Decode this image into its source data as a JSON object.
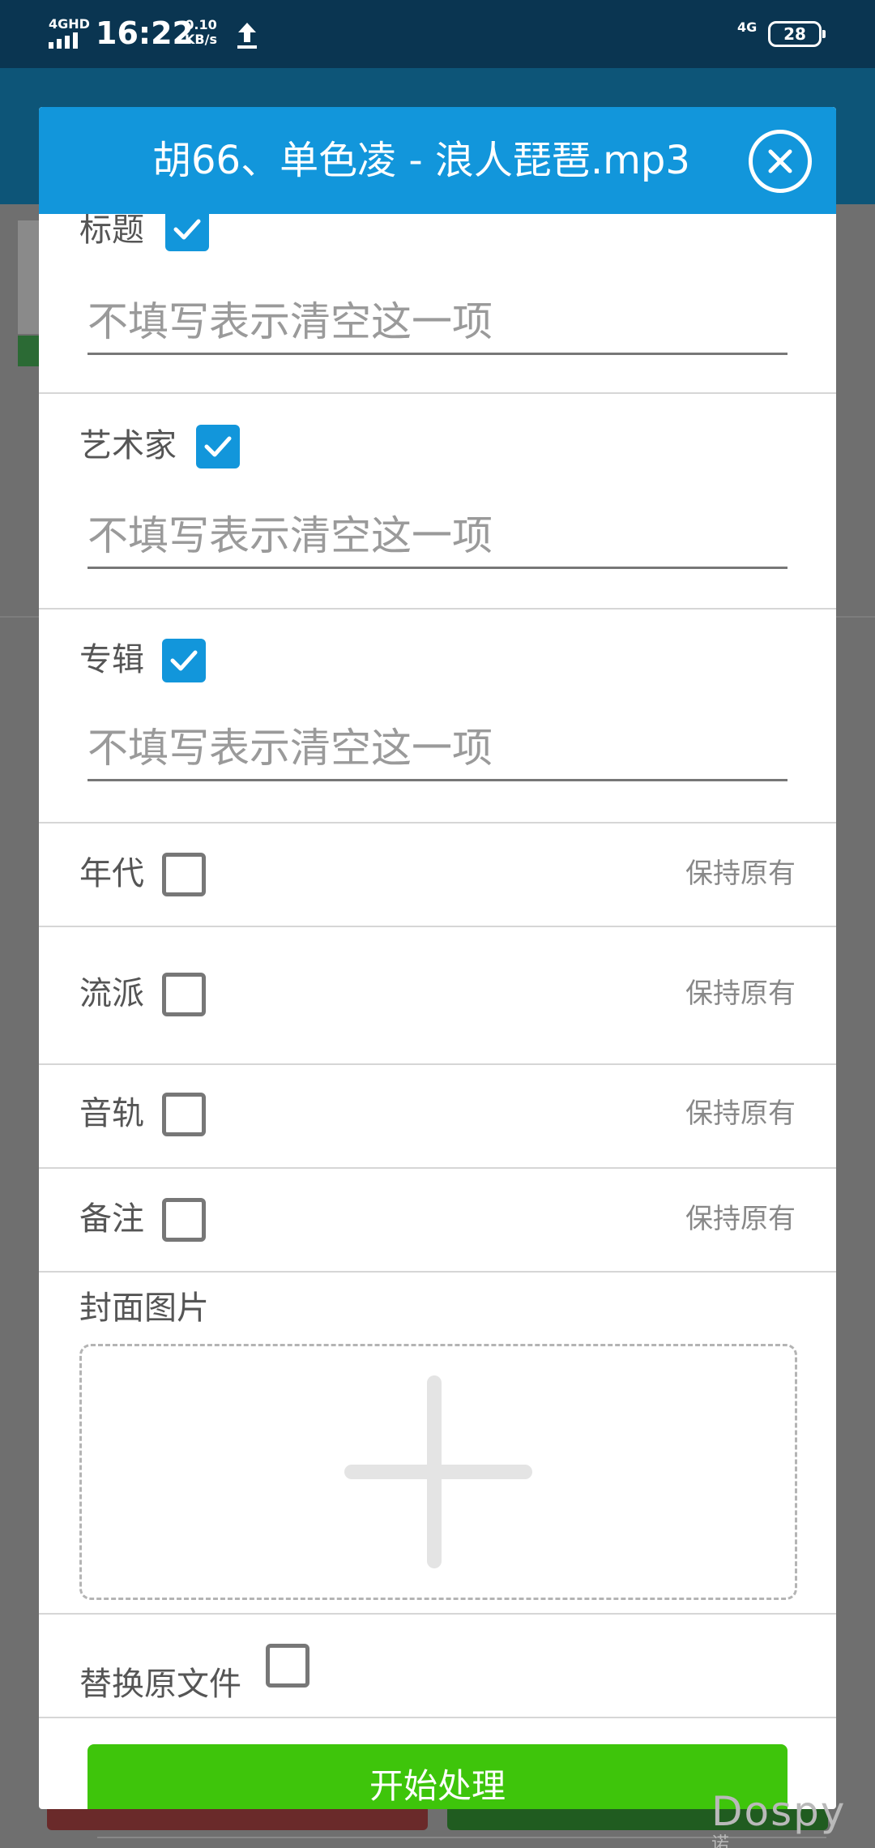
{
  "status_bar": {
    "network": "4GHD",
    "time": "16:22",
    "speed_value": "0.10",
    "speed_unit": "KB/s",
    "network_right": "4G",
    "battery": "28",
    "icons": [
      "signal-icon",
      "upload-icon",
      "battery-icon"
    ]
  },
  "dialog": {
    "title": "胡66、单色凌 - 浪人琵琶.mp3",
    "close_icon": "close-icon",
    "accent_color": "#1296db",
    "fields": [
      {
        "label": "标题",
        "checked": true,
        "placeholder": "不填写表示清空这一项",
        "value": ""
      },
      {
        "label": "艺术家",
        "checked": true,
        "placeholder": "不填写表示清空这一项",
        "value": ""
      },
      {
        "label": "专辑",
        "checked": true,
        "placeholder": "不填写表示清空这一项",
        "value": ""
      }
    ],
    "options": [
      {
        "label": "年代",
        "checked": false,
        "hint": "保持原有"
      },
      {
        "label": "流派",
        "checked": false,
        "hint": "保持原有"
      },
      {
        "label": "音轨",
        "checked": false,
        "hint": "保持原有"
      },
      {
        "label": "备注",
        "checked": false,
        "hint": "保持原有"
      }
    ],
    "cover": {
      "label": "封面图片",
      "icon": "plus-icon"
    },
    "replace": {
      "label": "替换原文件",
      "checked": false
    },
    "start_button": {
      "label": "开始处理",
      "color": "#3ec50b"
    }
  },
  "watermark": {
    "text": "Dospy",
    "sub": "诺亚方舟"
  }
}
